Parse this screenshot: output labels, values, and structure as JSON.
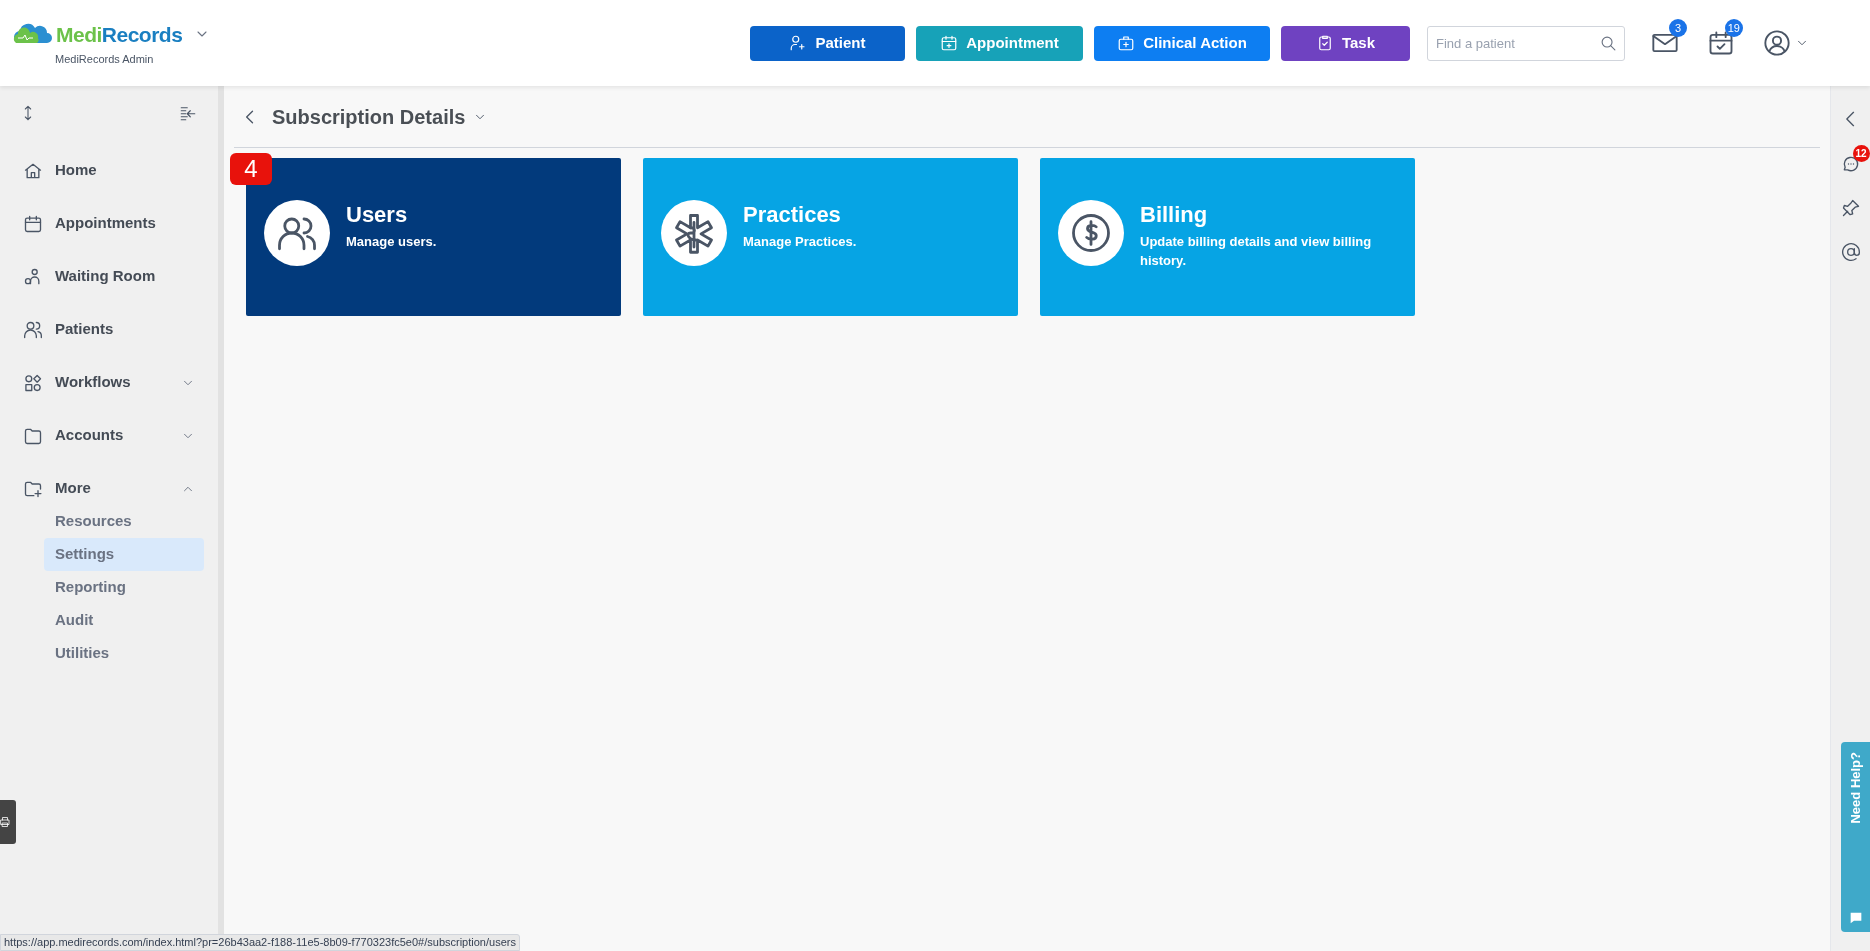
{
  "header": {
    "logo": {
      "brand_part1": "Medi",
      "brand_part2": "Records",
      "subtitle": "MediRecords Admin"
    },
    "actions": [
      {
        "label": "Patient"
      },
      {
        "label": "Appointment"
      },
      {
        "label": "Clinical Action"
      },
      {
        "label": "Task"
      }
    ],
    "search": {
      "placeholder": "Find a patient"
    },
    "mail_badge": "3",
    "calendar_badge": "19"
  },
  "sidebar": {
    "items": [
      {
        "label": "Home",
        "kind": "link"
      },
      {
        "label": "Appointments",
        "kind": "link"
      },
      {
        "label": "Waiting Room",
        "kind": "link"
      },
      {
        "label": "Patients",
        "kind": "link"
      },
      {
        "label": "Workflows",
        "kind": "group",
        "expanded": false
      },
      {
        "label": "Accounts",
        "kind": "group",
        "expanded": false
      },
      {
        "label": "More",
        "kind": "group",
        "expanded": true,
        "children": [
          {
            "label": "Resources",
            "selected": false
          },
          {
            "label": "Settings",
            "selected": true
          },
          {
            "label": "Reporting",
            "selected": false
          },
          {
            "label": "Audit",
            "selected": false
          },
          {
            "label": "Utilities",
            "selected": false
          }
        ]
      }
    ]
  },
  "page": {
    "title": "Subscription Details",
    "cards": [
      {
        "title": "Users",
        "description": "Manage users.",
        "selected": true,
        "badge": "4"
      },
      {
        "title": "Practices",
        "description": "Manage Practices.",
        "selected": false
      },
      {
        "title": "Billing",
        "description": "Update billing details and view billing history.",
        "selected": false
      }
    ]
  },
  "right_rail": {
    "chat_badge": "12"
  },
  "help_tab": {
    "label": "Need Help?"
  },
  "status_bar": {
    "url": "https://app.medirecords.com/index.html?pr=26b43aa2-f188-11e5-8b09-f770323fc5e0#/subscription/users"
  }
}
